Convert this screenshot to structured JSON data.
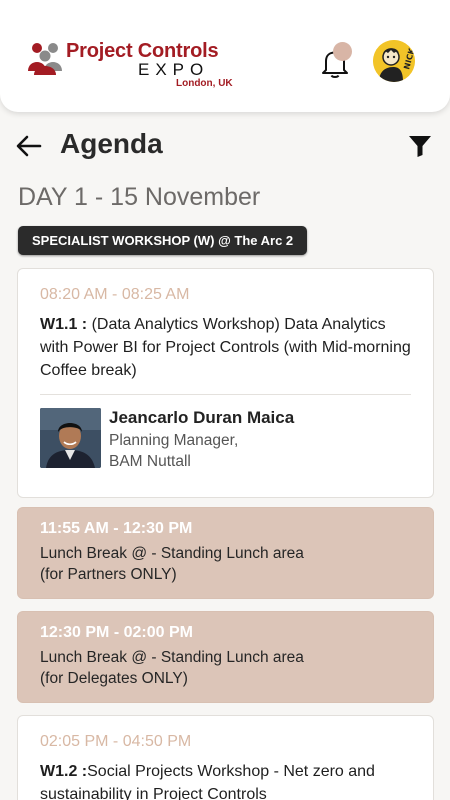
{
  "header": {
    "logo_title": "Project Controls",
    "logo_expo": "EXPO",
    "logo_location": "London, UK",
    "avatar_text": "NICK",
    "brand_color": "#a31c23"
  },
  "page": {
    "title": "Agenda",
    "day_label": "DAY 1 - 15 November",
    "track_pill": "SPECIALIST WORKSHOP (W) @ The Arc 2"
  },
  "sessions": [
    {
      "time": "08:20 AM - 08:25 AM",
      "code": "W1.1 :",
      "title": " (Data Analytics Workshop) Data Analytics with Power BI for Project Controls (with Mid-morning Coffee break)",
      "speaker": {
        "name": "Jeancarlo Duran Maica",
        "role_line1": "Planning Manager,",
        "role_line2": "BAM Nuttall"
      }
    },
    {
      "time": "11:55 AM - 12:30 PM",
      "title_line1": "Lunch Break @ - Standing Lunch area",
      "title_line2": "(for Partners ONLY)"
    },
    {
      "time": "12:30 PM - 02:00 PM",
      "title_line1": "Lunch Break @ - Standing Lunch area",
      "title_line2": "(for Delegates ONLY)"
    },
    {
      "time": "02:05 PM - 04:50 PM",
      "code": "W1.2 :",
      "title": "Social Projects Workshop - Net zero and sustainability in Project Controls"
    }
  ],
  "colors": {
    "break_card": "#dcc5b8",
    "time_text": "#d8b8a4",
    "pill_bg": "#2b2b2b"
  },
  "icons": [
    "back-arrow-icon",
    "filter-icon",
    "bell-icon",
    "user-avatar"
  ]
}
